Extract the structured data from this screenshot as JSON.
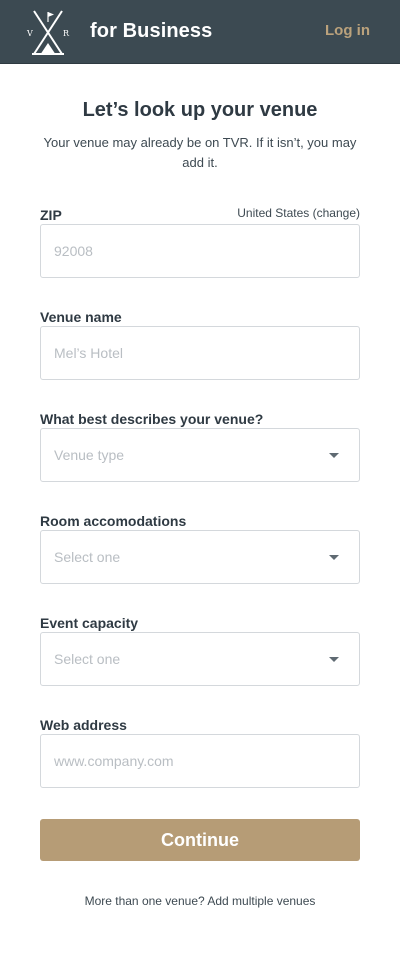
{
  "header": {
    "logo_letters": [
      "V",
      "R"
    ],
    "brand_suffix": "for Business",
    "login_label": "Log in"
  },
  "intro": {
    "title": "Let’s look up your venue",
    "subtitle": "Your venue may already be on TVR. If it isn’t, you may add it."
  },
  "form": {
    "zip": {
      "label": "ZIP",
      "country_link": "United States (change)",
      "value": "",
      "placeholder": "92008"
    },
    "venue_name": {
      "label": "Venue name",
      "value": "",
      "placeholder": "Mel’s Hotel"
    },
    "venue_type": {
      "label": "What best describes your venue?",
      "selected": "Venue type"
    },
    "room_accommodations": {
      "label": "Room accomodations",
      "selected": "Select one"
    },
    "event_capacity": {
      "label": "Event capacity",
      "selected": "Select one"
    },
    "web_address": {
      "label": "Web address",
      "value": "",
      "placeholder": "www.company.com"
    },
    "continue_label": "Continue"
  },
  "footer": {
    "multiple_venues_text": "More than one venue? Add multiple venues"
  },
  "colors": {
    "header_bg": "#3c4a52",
    "accent": "#b69c76",
    "login_text": "#bba27c"
  }
}
